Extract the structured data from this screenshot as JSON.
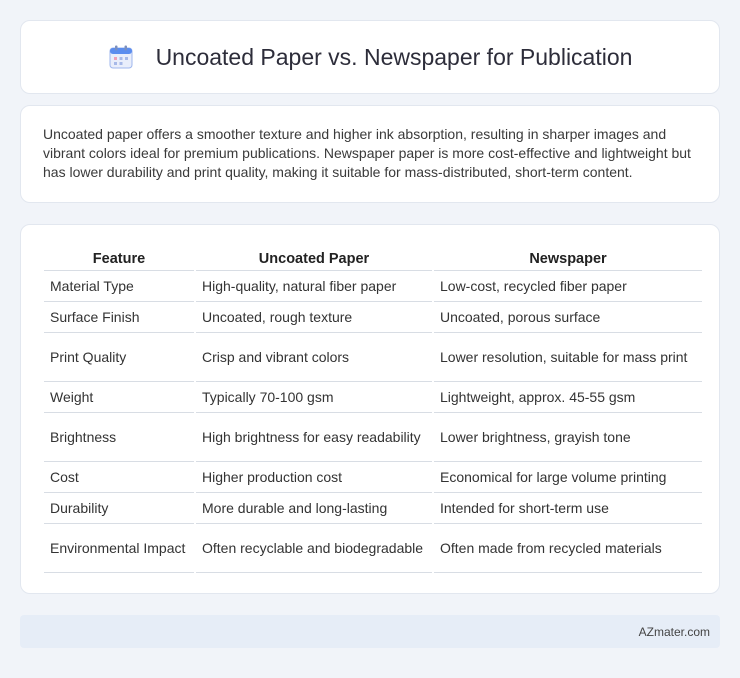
{
  "header": {
    "title": "Uncoated Paper vs. Newspaper for Publication",
    "icon": "calendar-icon"
  },
  "intro": {
    "text": "Uncoated paper offers a smoother texture and higher ink absorption, resulting in sharper images and vibrant colors ideal for premium publications. Newspaper paper is more cost-effective and lightweight but has lower durability and print quality, making it suitable for mass-distributed, short-term content."
  },
  "table": {
    "headers": [
      "Feature",
      "Uncoated Paper",
      "Newspaper"
    ],
    "rows": [
      [
        "Material Type",
        "High-quality, natural fiber paper",
        "Low-cost, recycled fiber paper"
      ],
      [
        "Surface Finish",
        "Uncoated, rough texture",
        "Uncoated, porous surface"
      ],
      [
        "Print Quality",
        "Crisp and vibrant colors",
        "Lower resolution, suitable for mass print"
      ],
      [
        "Weight",
        "Typically 70-100 gsm",
        "Lightweight, approx. 45-55 gsm"
      ],
      [
        "Brightness",
        "High brightness for easy readability",
        "Lower brightness, grayish tone"
      ],
      [
        "Cost",
        "Higher production cost",
        "Economical for large volume printing"
      ],
      [
        "Durability",
        "More durable and long-lasting",
        "Intended for short-term use"
      ],
      [
        "Environmental Impact",
        "Often recyclable and biodegradable",
        "Often made from recycled materials"
      ]
    ]
  },
  "footer": {
    "text": "AZmater.com"
  },
  "colors": {
    "background": "#f1f4f9",
    "card": "#ffffff",
    "footer_bar": "#e6edf7",
    "icon_accent": "#5b8def"
  }
}
